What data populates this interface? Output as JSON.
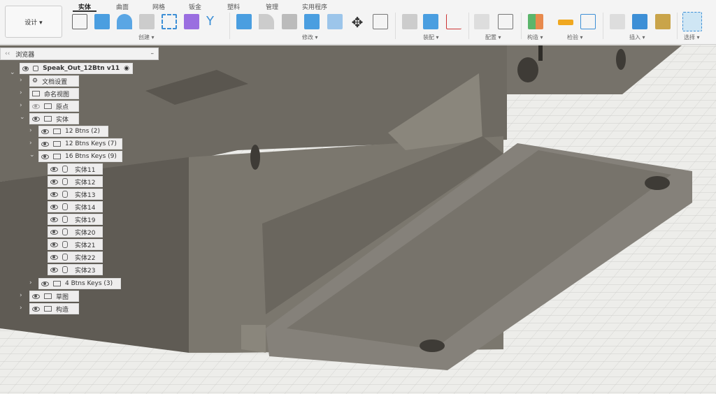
{
  "workspace": "设计 ▾",
  "tabs": [
    "实体",
    "曲面",
    "网格",
    "钣金",
    "塑料",
    "管理",
    "实用程序"
  ],
  "groups": [
    "创建 ▾",
    "修改 ▾",
    "装配 ▾",
    "配置 ▾",
    "构造 ▾",
    "检验 ▾",
    "插入 ▾",
    "选择 ▾"
  ],
  "browser": {
    "title": "浏览器",
    "collapse": "‹‹",
    "minimize": "–",
    "root": "Speak_Out_12Btn v11",
    "items": [
      "文档设置",
      "命名视图",
      "原点",
      "实体"
    ],
    "folders": [
      "12 Btns (2)",
      "12 Btns Keys (7)",
      "16 Btns Keys (9)"
    ],
    "bodies": [
      "实体11",
      "实体12",
      "实体13",
      "实体14",
      "实体19",
      "实体20",
      "实体21",
      "实体22",
      "实体23"
    ],
    "folder4": "4 Btns Keys (3)",
    "tail": [
      "草图",
      "构造"
    ]
  },
  "colors": {
    "accent": "#3d8fd6",
    "model": "#7a766c"
  }
}
